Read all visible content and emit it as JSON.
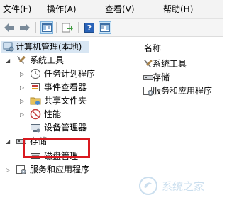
{
  "menu": {
    "file": "文件(F)",
    "action": "操作(A)",
    "view": "查看(V)",
    "help": "帮助(H)"
  },
  "toolbar": {
    "buttons": [
      "back-icon",
      "forward-icon",
      "show-tree-icon",
      "export-list-icon",
      "help-icon",
      "properties-icon"
    ]
  },
  "tree": {
    "root": "计算机管理(本地)",
    "system_tools": "系统工具",
    "task_scheduler": "任务计划程序",
    "event_viewer": "事件查看器",
    "shared_folders": "共享文件夹",
    "performance": "性能",
    "device_manager": "设备管理器",
    "storage": "存储",
    "disk_management": "磁盘管理",
    "services_apps": "服务和应用程序"
  },
  "right": {
    "column_header": "名称",
    "items": [
      "系统工具",
      "存储",
      "服务和应用程序"
    ]
  },
  "watermark": {
    "text": "系统之家"
  },
  "colors": {
    "highlight": "#d9191f",
    "selection": "#d8e6f3"
  }
}
